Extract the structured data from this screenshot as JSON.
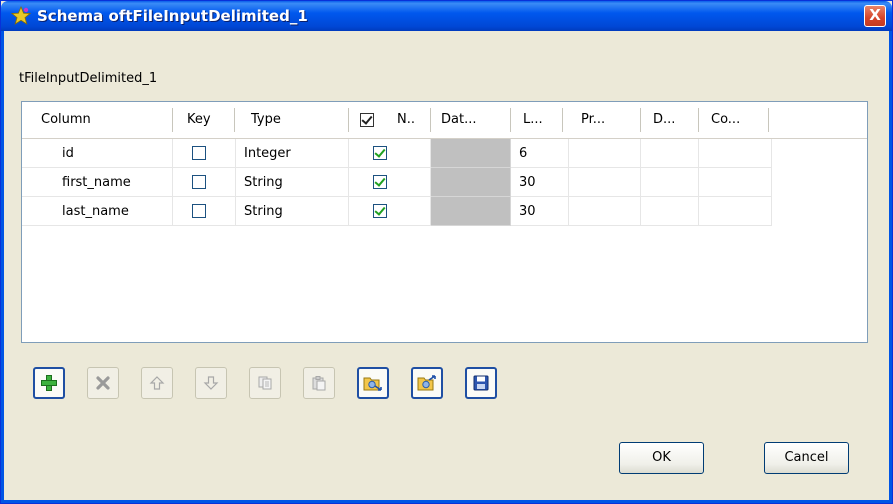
{
  "window": {
    "title": "Schema oftFileInputDelimited_1",
    "close_glyph": "X",
    "colors": {
      "titlebar": "#0058ee",
      "body": "#ece9d8",
      "close": "#d5442a"
    }
  },
  "component_label": "tFileInputDelimited_1",
  "grid": {
    "columns": [
      {
        "label": "Column"
      },
      {
        "label": "Key"
      },
      {
        "label": "Type"
      },
      {
        "label": "N.."
      },
      {
        "label": "Dat..."
      },
      {
        "label": "L..."
      },
      {
        "label": "Pr..."
      },
      {
        "label": "D..."
      },
      {
        "label": "Co..."
      }
    ],
    "nullable_header_checked": true,
    "rows": [
      {
        "column": "id",
        "key": false,
        "type": "Integer",
        "nullable": true,
        "date_pattern": "",
        "length": "6",
        "precision": "",
        "default": "",
        "comment": ""
      },
      {
        "column": "first_name",
        "key": false,
        "type": "String",
        "nullable": true,
        "date_pattern": "",
        "length": "30",
        "precision": "",
        "default": "",
        "comment": ""
      },
      {
        "column": "last_name",
        "key": false,
        "type": "String",
        "nullable": true,
        "date_pattern": "",
        "length": "30",
        "precision": "",
        "default": "",
        "comment": ""
      }
    ]
  },
  "toolbar": {
    "buttons": [
      {
        "icon": "add-icon",
        "enabled": true
      },
      {
        "icon": "remove-icon",
        "enabled": false
      },
      {
        "icon": "move-up-icon",
        "enabled": false
      },
      {
        "icon": "move-down-icon",
        "enabled": false
      },
      {
        "icon": "copy-icon",
        "enabled": false
      },
      {
        "icon": "paste-icon",
        "enabled": false
      },
      {
        "icon": "import-schema-icon",
        "enabled": true
      },
      {
        "icon": "export-schema-icon",
        "enabled": true
      },
      {
        "icon": "save-icon",
        "enabled": true
      }
    ]
  },
  "buttons": {
    "ok": "OK",
    "cancel": "Cancel"
  }
}
